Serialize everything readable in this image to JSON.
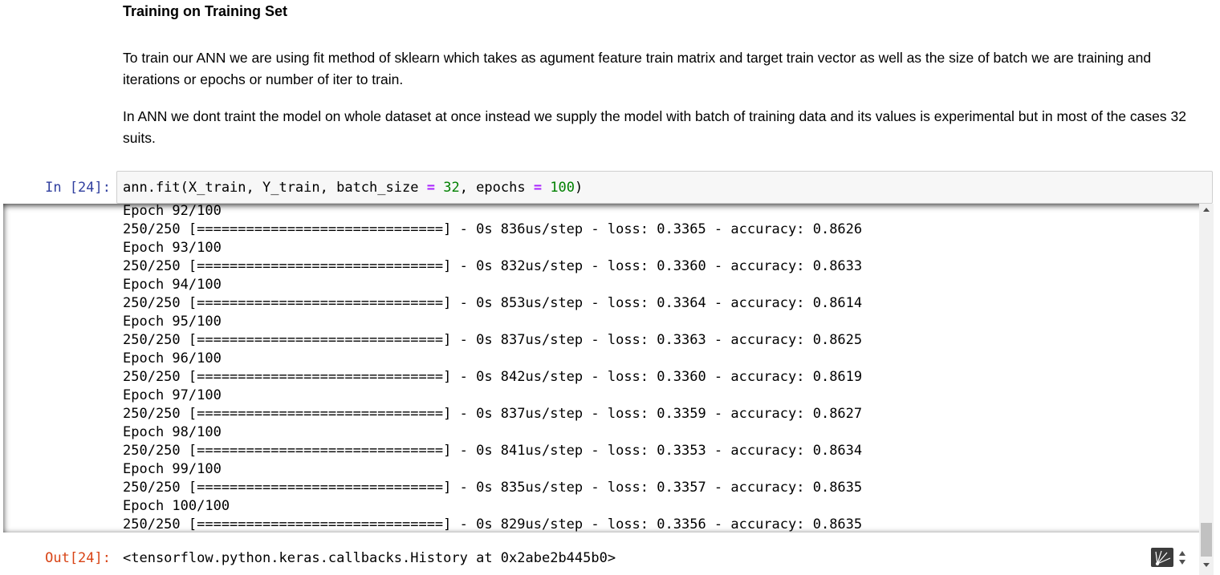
{
  "markdown": {
    "heading": "Training on Training Set",
    "paragraph_1": "To train our ANN we are using fit method of sklearn which takes as agument feature train matrix and target train vector as well as the size of batch we are training and iterations or epochs or number of iter to train.",
    "paragraph_2": "In ANN we dont traint the model on whole dataset at once instead we supply the model with batch of training data and its values is experimental but in most of the cases 32 suits."
  },
  "cell": {
    "in_prompt": "In [24]:",
    "out_prompt": "Out[24]:",
    "code": {
      "t1": "ann.fit(X_train, Y_train, batch_size ",
      "op1": "=",
      "t2": " ",
      "n1": "32",
      "t3": ", epochs ",
      "op2": "=",
      "t4": " ",
      "n2": "100",
      "t5": ")"
    },
    "stream_output": "Epoch 92/100\n250/250 [==============================] - 0s 836us/step - loss: 0.3365 - accuracy: 0.8626\nEpoch 93/100\n250/250 [==============================] - 0s 832us/step - loss: 0.3360 - accuracy: 0.8633\nEpoch 94/100\n250/250 [==============================] - 0s 853us/step - loss: 0.3364 - accuracy: 0.8614\nEpoch 95/100\n250/250 [==============================] - 0s 837us/step - loss: 0.3363 - accuracy: 0.8625\nEpoch 96/100\n250/250 [==============================] - 0s 842us/step - loss: 0.3360 - accuracy: 0.8619\nEpoch 97/100\n250/250 [==============================] - 0s 837us/step - loss: 0.3359 - accuracy: 0.8627\nEpoch 98/100\n250/250 [==============================] - 0s 841us/step - loss: 0.3353 - accuracy: 0.8634\nEpoch 99/100\n250/250 [==============================] - 0s 835us/step - loss: 0.3357 - accuracy: 0.8635\nEpoch 100/100\n250/250 [==============================] - 0s 829us/step - loss: 0.3356 - accuracy: 0.8635",
    "result": "<tensorflow.python.keras.callbacks.History at 0x2abe2b445b0>"
  },
  "colors": {
    "in_prompt": "#303f9f",
    "out_prompt": "#d84315",
    "operator": "#aa22ff",
    "number": "#008000"
  },
  "icons": {
    "gesture_widget": "scroll-gesture-icon"
  }
}
